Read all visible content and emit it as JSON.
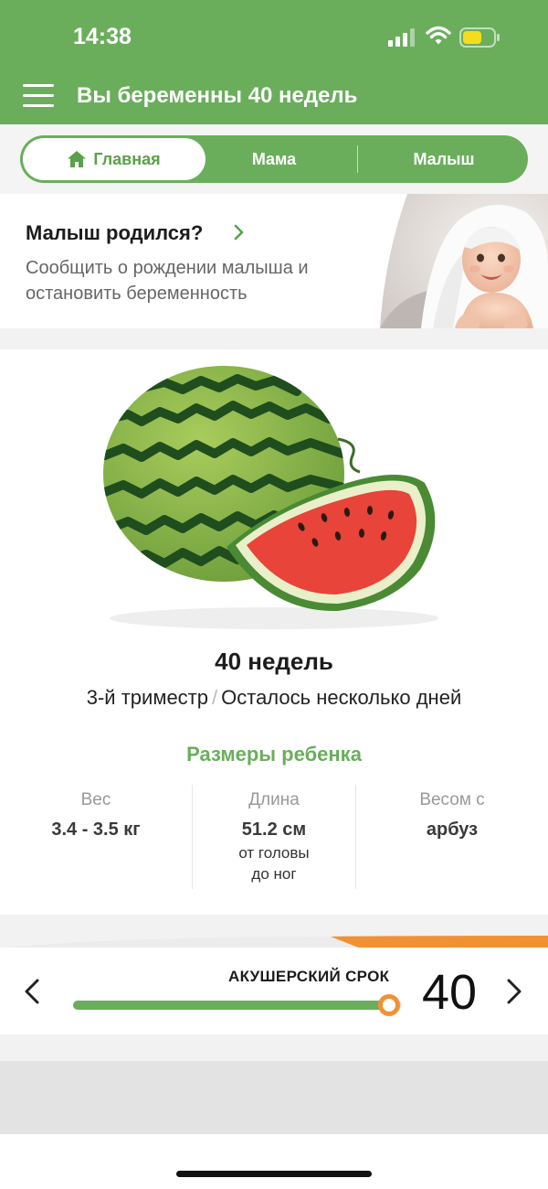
{
  "status_bar": {
    "time": "14:38",
    "icons": [
      "cellular-signal-icon",
      "wifi-icon",
      "battery-icon"
    ],
    "battery_color": "#f7dc1e"
  },
  "header": {
    "menu_icon": "hamburger-menu-icon",
    "title": "Вы беременны 40 недель",
    "background": "#6aae5c"
  },
  "tabs": [
    {
      "label": "Главная",
      "icon": "home-icon",
      "active": true
    },
    {
      "label": "Мама",
      "active": false
    },
    {
      "label": "Малыш",
      "active": false
    }
  ],
  "promo": {
    "title": "Малыш родился?",
    "chevron_icon": "chevron-right-icon",
    "description_line1": "Сообщить о рождении малыша и",
    "description_line2": "остановить беременность",
    "image": "smiling-baby-under-towel-photo"
  },
  "week_info": {
    "image": "watermelon-illustration",
    "weeks": "40 недель",
    "trimester": "3-й триместр",
    "separator": "/",
    "remaining": "Осталось несколько дней"
  },
  "baby_sizes": {
    "title": "Размеры ребенка",
    "weight": {
      "label": "Вес",
      "value": "3.4 - 3.5 кг"
    },
    "length": {
      "label": "Длина",
      "value": "51.2 см",
      "sub_line1": "от головы",
      "sub_line2": "до ног"
    },
    "compare": {
      "label": "Весом с",
      "value": "арбуз"
    }
  },
  "week_selector": {
    "label": "АКУШЕРСКИЙ СРОК",
    "week": "40",
    "progress": 0.96,
    "prev_icon": "chevron-left-icon",
    "next_icon": "chevron-right-icon",
    "accent_color": "#f29134"
  }
}
